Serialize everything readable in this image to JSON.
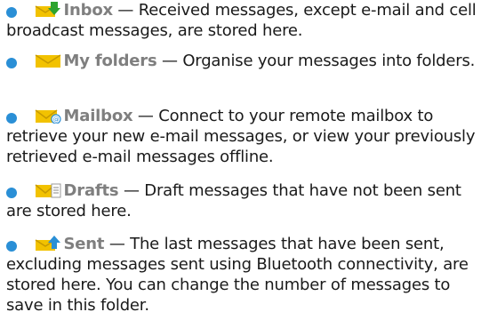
{
  "items": [
    {
      "title": "Inbox",
      "description": " — Received messages, except e-mail and cell broadcast messages, are stored here.",
      "icon": "inbox-icon",
      "accent": "#2ea32e"
    },
    {
      "title": "My folders",
      "description": " — Organise your messages into folders.",
      "icon": "my-folders-icon",
      "accent": "#f2c200"
    },
    {
      "title": "Mailbox",
      "description": " — Connect to your remote mailbox to retrieve your new e-mail messages, or view your previously retrieved e-mail messages offline.",
      "icon": "mailbox-icon",
      "accent": "#2a8fd6"
    },
    {
      "title": "Drafts",
      "description": " — Draft messages that have not been sent are stored here.",
      "icon": "drafts-icon",
      "accent": "#f2c200"
    },
    {
      "title": "Sent",
      "description": " — The last messages that have been sent, excluding messages sent using Bluetooth connectivity, are stored here. You can change the number of messages to save in this folder.",
      "icon": "sent-icon",
      "accent": "#2a8fd6"
    }
  ],
  "colors": {
    "bullet": "#2a8fd6",
    "title": "#7f7f7f",
    "text": "#1a1a1a",
    "envelope": "#f2c200"
  }
}
